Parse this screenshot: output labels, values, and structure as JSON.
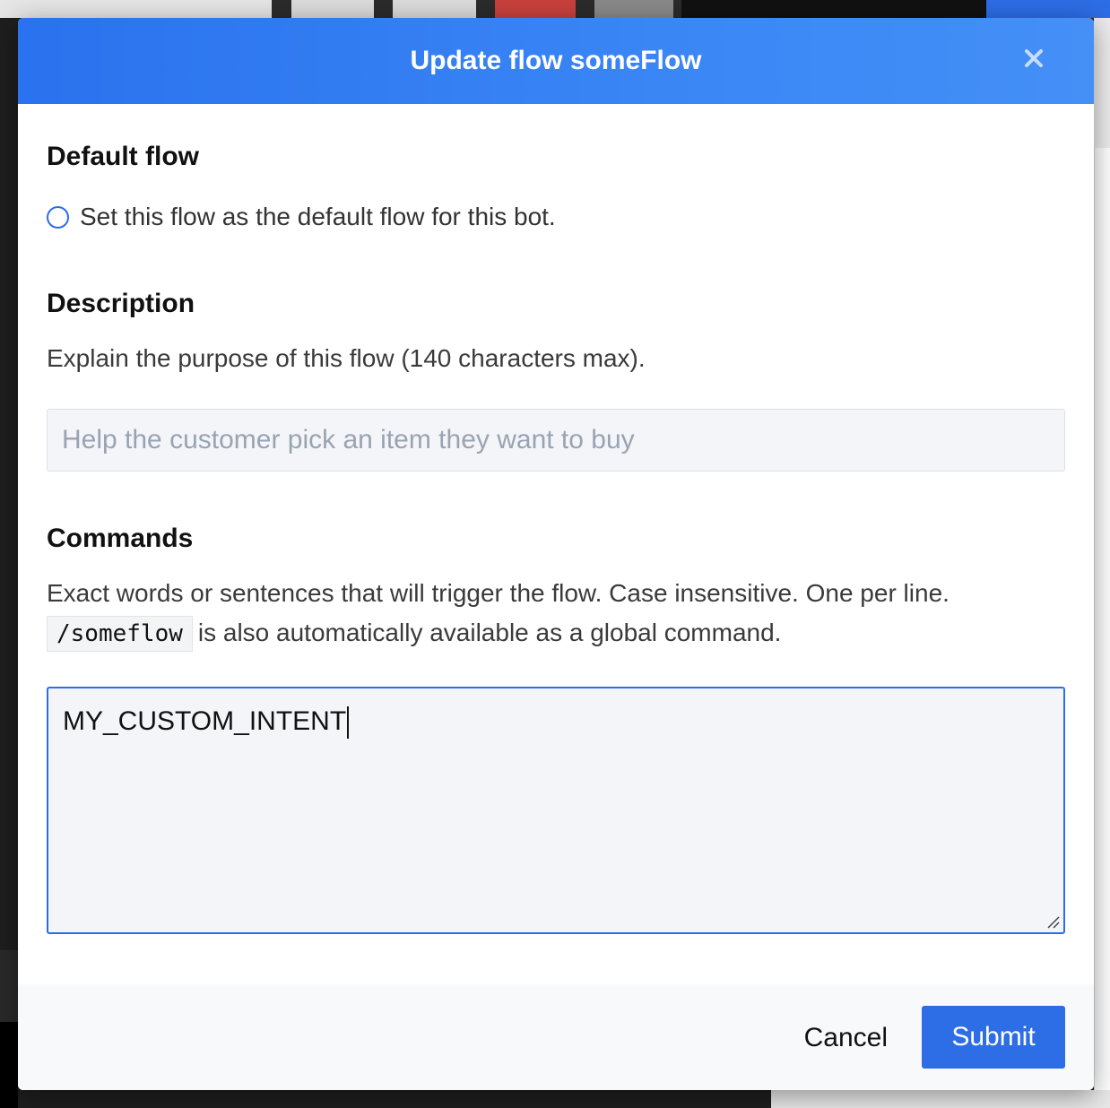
{
  "modal": {
    "title": "Update flow someFlow"
  },
  "default_flow": {
    "heading": "Default flow",
    "radio_label": "Set this flow as the default flow for this bot."
  },
  "description": {
    "heading": "Description",
    "help": "Explain the purpose of this flow (140 characters max).",
    "placeholder": "Help the customer pick an item they want to buy",
    "value": ""
  },
  "commands": {
    "heading": "Commands",
    "help_line1": "Exact words or sentences that will trigger the flow. Case insensitive. One per line.",
    "global_command": "/someflow",
    "help_line2": "is also automatically available as a global command.",
    "value": "MY_CUSTOM_INTENT"
  },
  "footer": {
    "cancel_label": "Cancel",
    "submit_label": "Submit"
  },
  "colors": {
    "accent": "#2d6de6",
    "header_gradient_start": "#2a72ee",
    "header_gradient_end": "#4490f7"
  }
}
